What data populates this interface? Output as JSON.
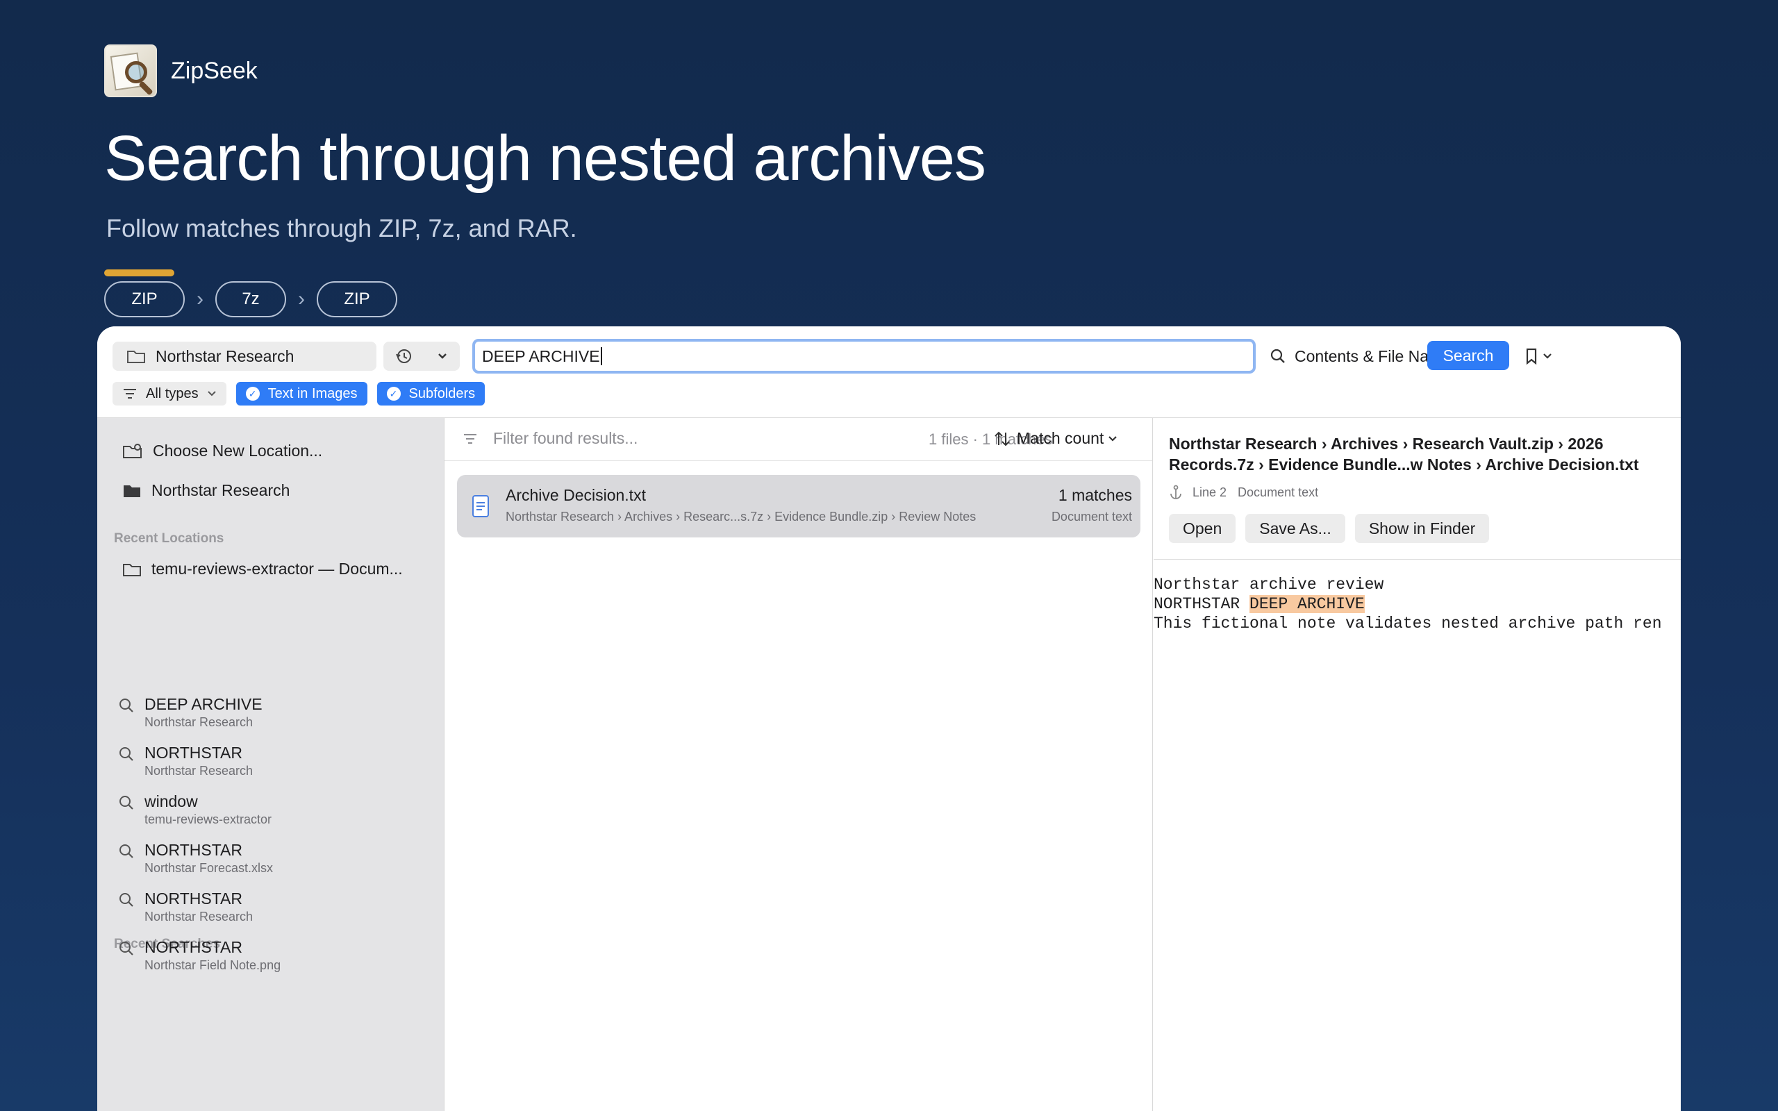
{
  "hero": {
    "app_name": "ZipSeek",
    "title": "Search through nested archives",
    "subtitle": "Follow matches through ZIP, 7z, and RAR.",
    "accent_color": "#e0a534",
    "chips": [
      "ZIP",
      "7z",
      "ZIP"
    ]
  },
  "toolbar": {
    "location": "Northstar Research",
    "search_query": "DEEP ARCHIVE",
    "scope": "Contents & File Names",
    "search_button": "Search",
    "accent_color": "#2f7cf6",
    "filters": {
      "type": "All types",
      "text_in_images": "Text in Images",
      "subfolders": "Subfolders"
    }
  },
  "sidebar": {
    "choose_location": "Choose New Location...",
    "current_location": "Northstar Research",
    "recent_locations_header": "Recent Locations",
    "recent_locations": [
      "temu-reviews-extractor — Docum..."
    ],
    "recent_searches_header": "Recent Searches",
    "recent_searches": [
      {
        "query": "DEEP ARCHIVE",
        "location": "Northstar Research"
      },
      {
        "query": "NORTHSTAR",
        "location": "Northstar Research"
      },
      {
        "query": "window",
        "location": "temu-reviews-extractor"
      },
      {
        "query": "NORTHSTAR",
        "location": "Northstar Forecast.xlsx"
      },
      {
        "query": "NORTHSTAR",
        "location": "Northstar Research"
      },
      {
        "query": "NORTHSTAR",
        "location": "Northstar Field Note.png"
      }
    ]
  },
  "results": {
    "filter_placeholder": "Filter found results...",
    "count": "1 files · 1 matches",
    "sort_label": "Match count",
    "rows": [
      {
        "name": "Archive Decision.txt",
        "path": "Northstar Research › Archives › Researc...s.7z › Evidence Bundle.zip › Review Notes",
        "matches": "1 matches",
        "kind": "Document text"
      }
    ]
  },
  "preview": {
    "title": "Northstar Research › Archives › Research Vault.zip › 2026 Records.7z › Evidence Bundle...w Notes › Archive Decision.txt",
    "line": "Line 2",
    "kind": "Document text",
    "buttons": {
      "open": "Open",
      "save_as": "Save As...",
      "show_in_finder": "Show in Finder"
    },
    "lines": {
      "l1": "Northstar archive review",
      "l2_prefix": "NORTHSTAR ",
      "l2_match": "DEEP ARCHIVE",
      "l3": "This fictional note validates nested archive path ren"
    },
    "highlight_color": "#f8c9a0"
  }
}
